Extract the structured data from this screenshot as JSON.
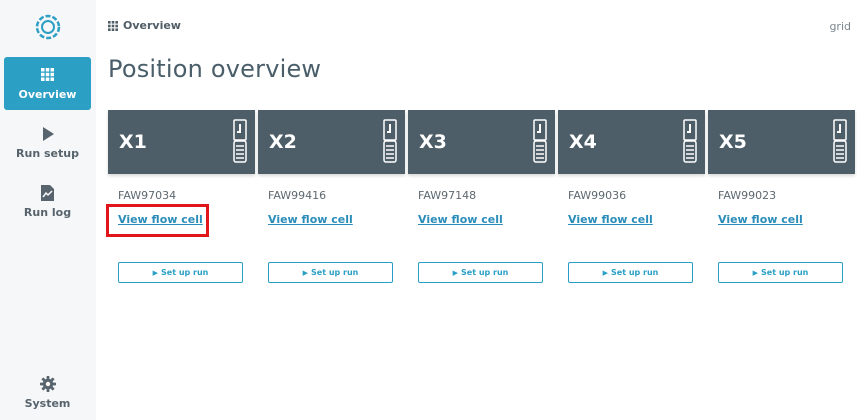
{
  "sidebar": {
    "items": [
      {
        "label": "Overview",
        "icon": "grid-icon",
        "active": true
      },
      {
        "label": "Run setup",
        "icon": "play-icon",
        "active": false
      },
      {
        "label": "Run log",
        "icon": "document-icon",
        "active": false
      },
      {
        "label": "System",
        "icon": "gear-icon",
        "active": false
      }
    ]
  },
  "header": {
    "breadcrumb": "Overview",
    "top_right": "grid"
  },
  "main": {
    "title": "Position overview",
    "positions": [
      {
        "name": "X1",
        "flow_cell_id": "FAW97034",
        "link": "View flow cell",
        "button": "Set up run"
      },
      {
        "name": "X2",
        "flow_cell_id": "FAW99416",
        "link": "View flow cell",
        "button": "Set up run"
      },
      {
        "name": "X3",
        "flow_cell_id": "FAW97148",
        "link": "View flow cell",
        "button": "Set up run"
      },
      {
        "name": "X4",
        "flow_cell_id": "FAW99036",
        "link": "View flow cell",
        "button": "Set up run"
      },
      {
        "name": "X5",
        "flow_cell_id": "FAW99023",
        "link": "View flow cell",
        "button": "Set up run"
      }
    ]
  },
  "colors": {
    "accent": "#2b9fc4",
    "position_header": "#4e5e69",
    "link": "#2a8cb8",
    "highlight": "#e0161b"
  }
}
